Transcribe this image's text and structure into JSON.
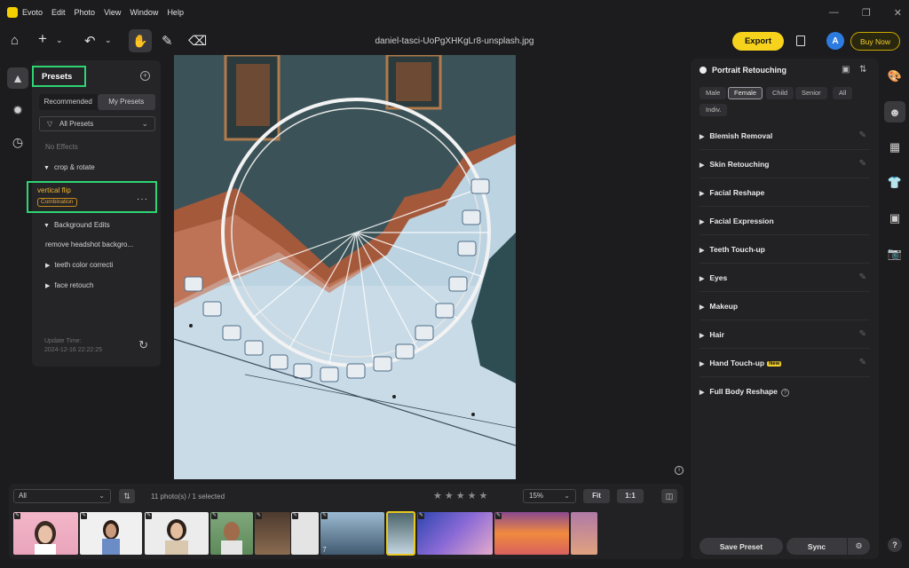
{
  "app": {
    "name": "Evoto"
  },
  "menu": [
    "Edit",
    "Photo",
    "View",
    "Window",
    "Help"
  ],
  "toolbar": {
    "file_name": "daniel-tasci-UoPgXHKgLr8-unsplash.jpg",
    "export_label": "Export",
    "avatar_letter": "A",
    "buy_label": "Buy Now"
  },
  "presets": {
    "title": "Presets",
    "tabs": [
      "Recommended",
      "My Presets"
    ],
    "filter": "All Presets",
    "items": {
      "no_effects": "No Effects",
      "crop_rotate": "crop & rotate",
      "vertical_flip": "vertical flip",
      "combination_badge": "Combination",
      "background_edits": "Background Edits",
      "remove_headshot": "remove headshot backgro...",
      "teeth_color": "teeth color correcti",
      "face_retouch": "face retouch"
    },
    "update_label": "Update Time:",
    "update_time": "2024-12-16 22:22:25"
  },
  "right_panel": {
    "title": "Portrait Retouching",
    "chips": [
      "Male",
      "Female",
      "Child",
      "Senior",
      "All",
      "Indiv."
    ],
    "selected_chip": "Female",
    "features": [
      "Blemish Removal",
      "Skin Retouching",
      "Facial Reshape",
      "Facial Expression",
      "Teeth Touch-up",
      "Eyes",
      "Makeup",
      "Hair",
      "Hand Touch-up",
      "Full Body Reshape"
    ],
    "new_badge": "New",
    "save_preset": "Save Preset",
    "sync": "Sync"
  },
  "filmstrip": {
    "filter": "All",
    "count_text": "11 photo(s) / 1 selected",
    "zoom": "15%",
    "fit": "Fit",
    "one_to_one": "1:1",
    "stack_count": "7"
  },
  "colors": {
    "accent": "#f6d21d",
    "highlight": "#2ed573",
    "preset_active": "#f0b72f"
  }
}
